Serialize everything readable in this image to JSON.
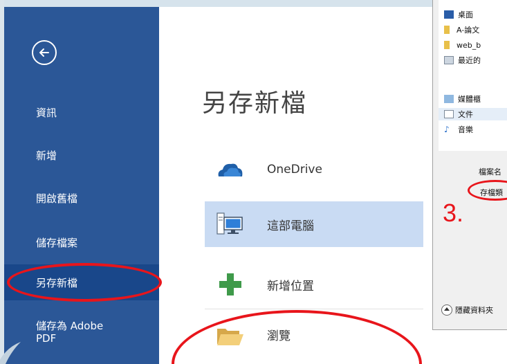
{
  "sidebar": {
    "items": [
      {
        "label": "資訊"
      },
      {
        "label": "新增"
      },
      {
        "label": "開啟舊檔"
      },
      {
        "label": "儲存檔案"
      },
      {
        "label": "另存新檔"
      },
      {
        "label": "儲存為 Adobe PDF"
      }
    ],
    "active_index": 4
  },
  "main": {
    "title": "另存新檔",
    "places": [
      {
        "label": "OneDrive",
        "icon": "cloud-icon"
      },
      {
        "label": "這部電腦",
        "icon": "computer-icon"
      },
      {
        "label": "新增位置",
        "icon": "plus-icon"
      },
      {
        "label": "瀏覽",
        "icon": "folder-icon"
      }
    ],
    "selected_place_index": 1
  },
  "dialog": {
    "tree": [
      {
        "label": "桌面",
        "icon": "desktop-icon"
      },
      {
        "label": "A-論文",
        "icon": "folder-icon"
      },
      {
        "label": "web_b",
        "icon": "folder-icon"
      },
      {
        "label": "最近的",
        "icon": "recent-icon"
      },
      {
        "label": "媒體櫃",
        "icon": "library-icon"
      },
      {
        "label": "文件",
        "icon": "document-icon"
      },
      {
        "label": "音樂",
        "icon": "music-icon"
      }
    ],
    "filename_label": "檔案名",
    "filetype_label": "存檔類",
    "hide_folders_label": "隱藏資料夾"
  },
  "annotation": {
    "step": "3."
  },
  "colors": {
    "sidebar": "#2b5797",
    "sidebar_active": "#19478a",
    "selected_place": "#c9dbf3",
    "annotation_red": "#e8151b"
  }
}
